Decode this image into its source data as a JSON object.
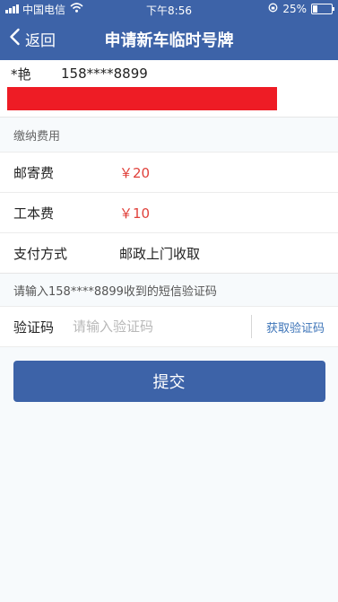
{
  "status_bar": {
    "carrier": "中国电信",
    "time": "下午8:56",
    "battery_text": "25%",
    "battery_level": 0.25
  },
  "nav": {
    "back_label": "返回",
    "title": "申请新车临时号牌"
  },
  "vehicle": {
    "plate": "*艳",
    "phone": "158****8899"
  },
  "fees": {
    "section_title": "缴纳费用",
    "postage_label": "邮寄费",
    "postage_value": "￥20",
    "production_label": "工本费",
    "production_value": "￥10",
    "payment_label": "支付方式",
    "payment_value": "邮政上门收取"
  },
  "verification": {
    "hint": "请输入158****8899收到的短信验证码",
    "code_label": "验证码",
    "code_placeholder": "请输入验证码",
    "get_code_label": "获取验证码"
  },
  "submit_label": "提交",
  "colors": {
    "primary": "#3d63a8",
    "price": "#e0413b",
    "redacted_bar": "#ee1c25",
    "link": "#3d74b8"
  },
  "icons": [
    "signal-icon",
    "wifi-icon",
    "rotation-lock-icon",
    "battery-icon",
    "chevron-left-icon"
  ]
}
